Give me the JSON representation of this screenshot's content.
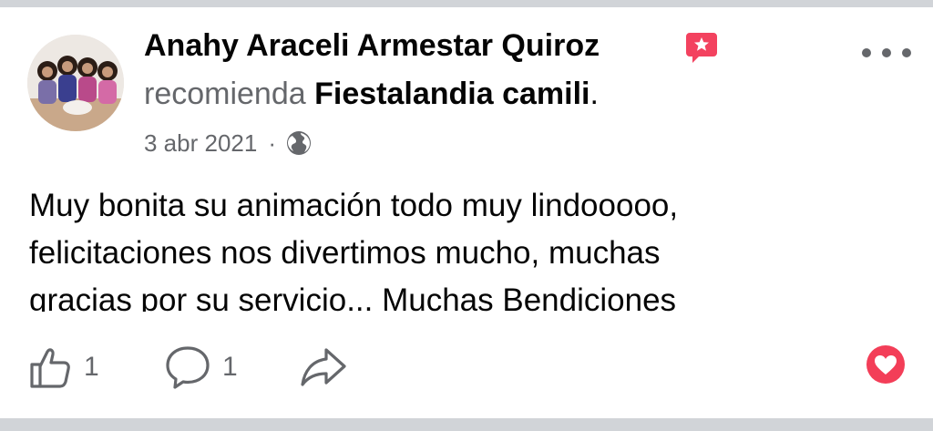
{
  "post": {
    "author": "Anahy Araceli Armestar Quiroz",
    "verb": "recomienda",
    "page_name": "Fiestalandia camili",
    "period": ".",
    "date": "3 abr 2021",
    "separator": "·",
    "privacy_icon": "globe-icon",
    "badge_icon": "recommendation-badge-icon",
    "text_lines": [
      "Muy bonita su animación todo muy lindooooo,",
      "felicitaciones nos divertimos mucho, muchas",
      "gracias por su servicio... Muchas Bendiciones"
    ]
  },
  "actions": {
    "like_count": "1",
    "comment_count": "1",
    "like_icon": "thumbs-up-icon",
    "comment_icon": "comment-icon",
    "share_icon": "share-icon",
    "reaction_icon": "heart-icon"
  },
  "colors": {
    "secondary_text": "#65676b",
    "badge": "#f3425f",
    "heart": "#f33e58",
    "divider": "#d1d4d8"
  }
}
